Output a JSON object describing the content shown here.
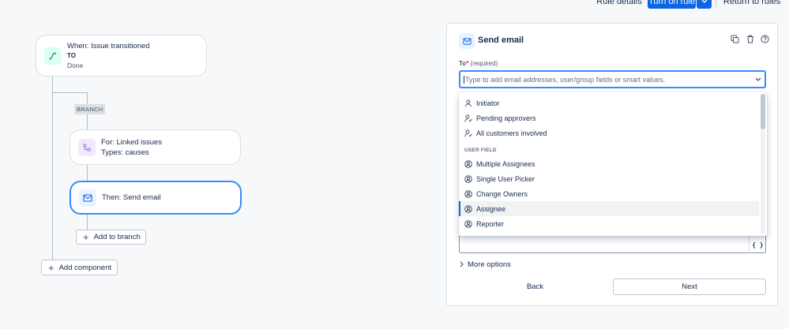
{
  "toolbar": {
    "rule_details": "Rule details",
    "turn_on_rule": "Turn on rule",
    "return_to_rules": "Return to rules"
  },
  "flow": {
    "trigger": {
      "line1": "When: Issue transitioned",
      "line2": "TO",
      "line3": "Done"
    },
    "branch_tag": "BRANCH",
    "branch": {
      "line1": "For: Linked issues",
      "line2": "Types: causes"
    },
    "action": {
      "line1": "Then: Send email"
    },
    "add_to_branch": "Add to branch",
    "add_component": "Add component"
  },
  "panel": {
    "title": "Send email",
    "to_label": "To",
    "required_mark": "*",
    "required_text": "(required)",
    "to_placeholder": "Type to add email addresses, user/group fields or smart values.",
    "dropdown": {
      "items_top": [
        "Initiator",
        "Pending approvers",
        "All customers involved"
      ],
      "group_label": "USER FIELD",
      "items_user_field": [
        "Multiple Assignees",
        "Single User Picker",
        "Change Owners",
        "Assignee",
        "Reporter"
      ],
      "selected": "Assignee"
    },
    "smart_value_button": "{ }",
    "more_options": "More options",
    "back": "Back",
    "next": "Next"
  },
  "colors": {
    "primary": "#0c66e4",
    "focus_border": "#388bff",
    "trigger_icon_bg": "#dcfff1",
    "branch_icon_bg": "#f3e8fd",
    "action_icon_bg": "#e9f2ff"
  }
}
